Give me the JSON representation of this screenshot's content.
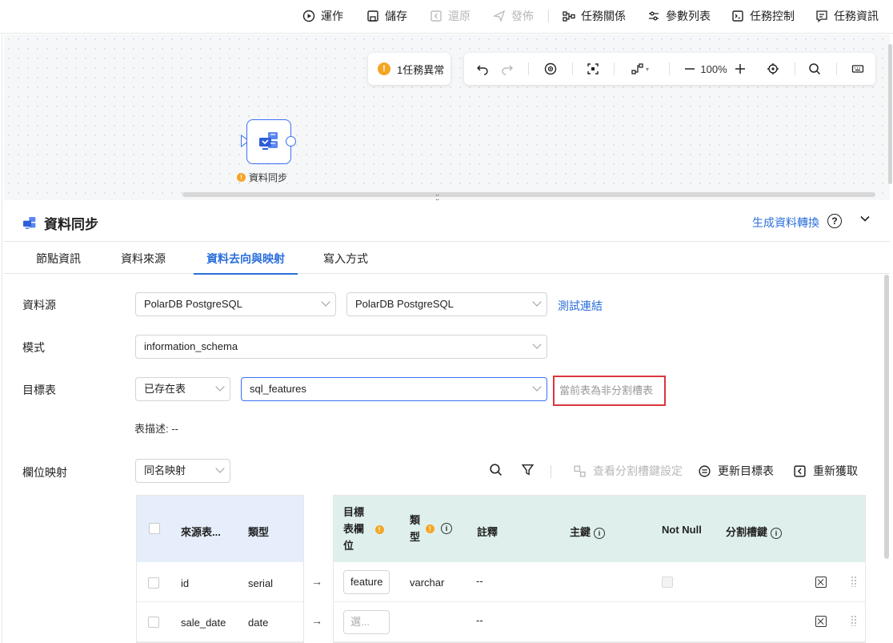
{
  "toolbar": {
    "run": "運作",
    "save": "儲存",
    "restore": "還原",
    "publish": "發佈",
    "task_relation": "任務關係",
    "param_list": "參數列表",
    "task_control": "任務控制",
    "task_info": "任務資訊"
  },
  "canvas": {
    "error_count": "1任務異常",
    "zoom": "100%",
    "node_label": "資料同步"
  },
  "panel": {
    "title": "資料同步",
    "generate_link": "生成資料轉換",
    "tabs": [
      "節點資訊",
      "資料來源",
      "資料去向與映射",
      "寫入方式"
    ],
    "active_tab": 2
  },
  "form": {
    "datasource_label": "資料源",
    "datasource_type": "PolarDB PostgreSQL",
    "datasource_name": "PolarDB PostgreSQL",
    "test_link": "測試連結",
    "schema_label": "模式",
    "schema_value": "information_schema",
    "target_label": "目標表",
    "target_mode": "已存在表",
    "target_table": "sql_features",
    "partition_note": "當前表為非分割槽表",
    "table_desc": "表描述:  --",
    "mapping_label": "欄位映射",
    "mapping_mode": "同名映射"
  },
  "mapping_tools": {
    "view_partition": "查看分割槽鍵設定",
    "refresh_target": "更新目標表",
    "refetch": "重新獲取"
  },
  "source_table": {
    "headers": [
      "來源表...",
      "類型"
    ],
    "rows": [
      {
        "name": "id",
        "type": "serial"
      },
      {
        "name": "sale_date",
        "type": "date"
      }
    ]
  },
  "target_table": {
    "header_field_l1": "目標",
    "header_field_l2": "表欄",
    "header_field_l3": "位",
    "header_type_l1": "類",
    "header_type_l2": "型",
    "header_comment": "註釋",
    "header_pk": "主鍵",
    "header_notnull": "Not Null",
    "header_partition": "分割槽鍵",
    "rows": [
      {
        "field": "feature",
        "type": "varchar",
        "comment": "--"
      },
      {
        "field": "選...",
        "type": "",
        "comment": "--"
      }
    ]
  },
  "colors": {
    "accent": "#2a6fdb",
    "warning": "#f5a524",
    "error_border": "#d9363e"
  }
}
